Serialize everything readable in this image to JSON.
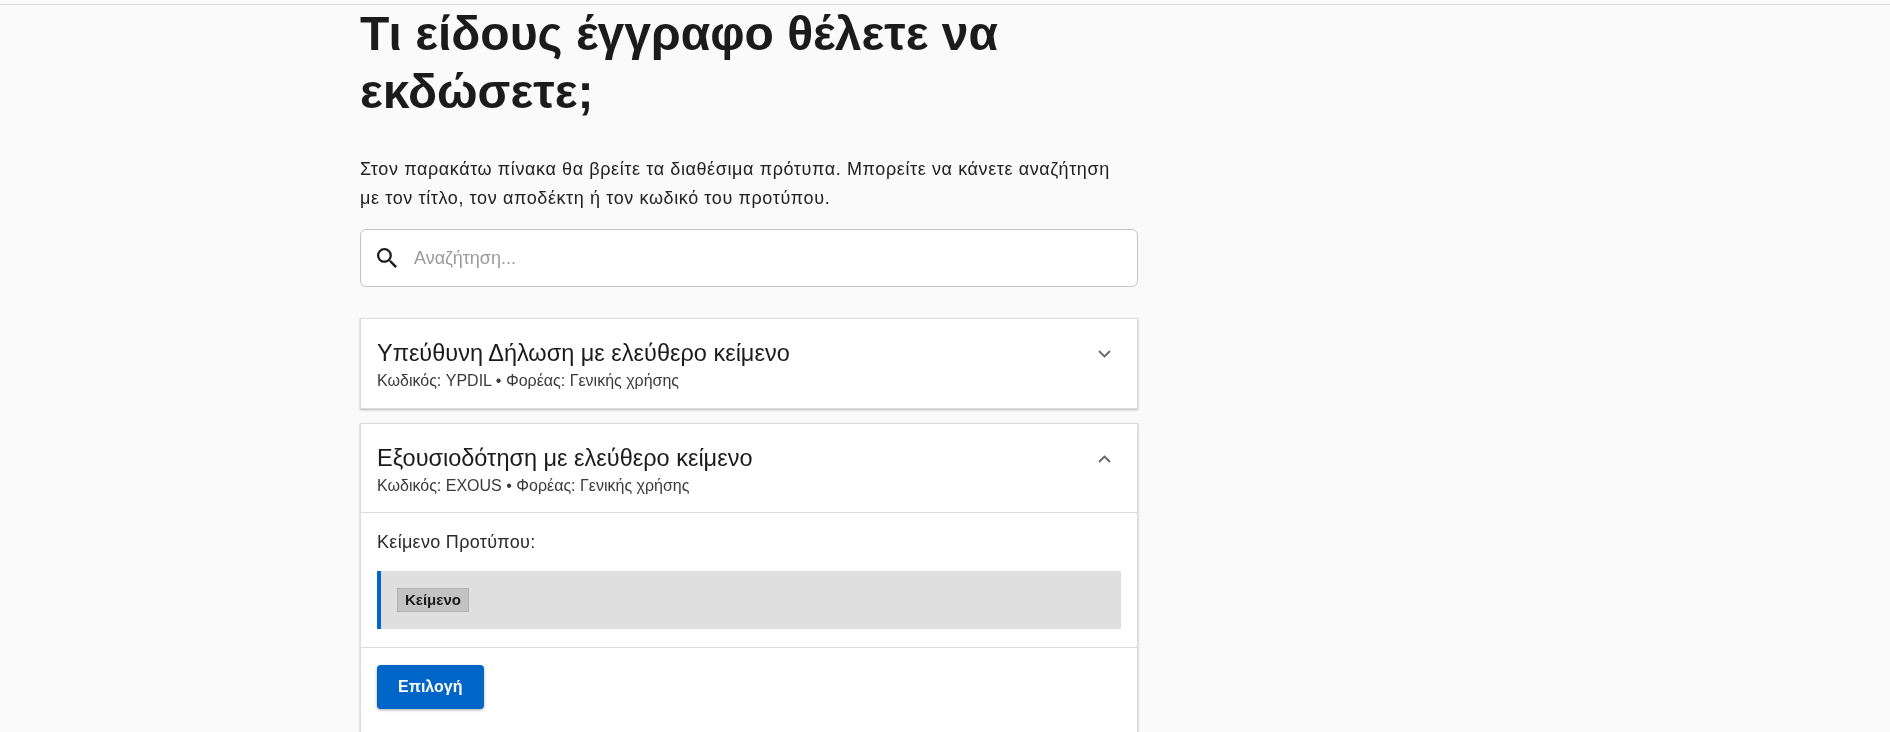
{
  "heading": "Τι είδους έγγραφο θέλετε να εκδώσετε;",
  "intro": "Στον παρακάτω πίνακα θα βρείτε τα διαθέσιμα πρότυπα. Μπορείτε να κάνετε αναζήτηση με τον τίτλο, τον αποδέκτη ή τον κωδικό του προτύπου.",
  "search": {
    "placeholder": "Αναζήτηση..."
  },
  "templates": [
    {
      "title": "Υπεύθυνη Δήλωση με ελεύθερο κείμενο",
      "meta": "Κωδικός: YPDIL • Φορέας: Γενικής χρήσης",
      "expanded": false
    },
    {
      "title": "Εξουσιοδότηση με ελεύθερο κείμενο",
      "meta": "Κωδικός: EXOUS • Φορέας: Γενικής χρήσης",
      "expanded": true,
      "body": {
        "label": "Κείμενο Προτύπου:",
        "template_text": [
          {
            "kind": "field",
            "text": "Κείμενο"
          }
        ],
        "button": "Επιλογή"
      }
    }
  ]
}
